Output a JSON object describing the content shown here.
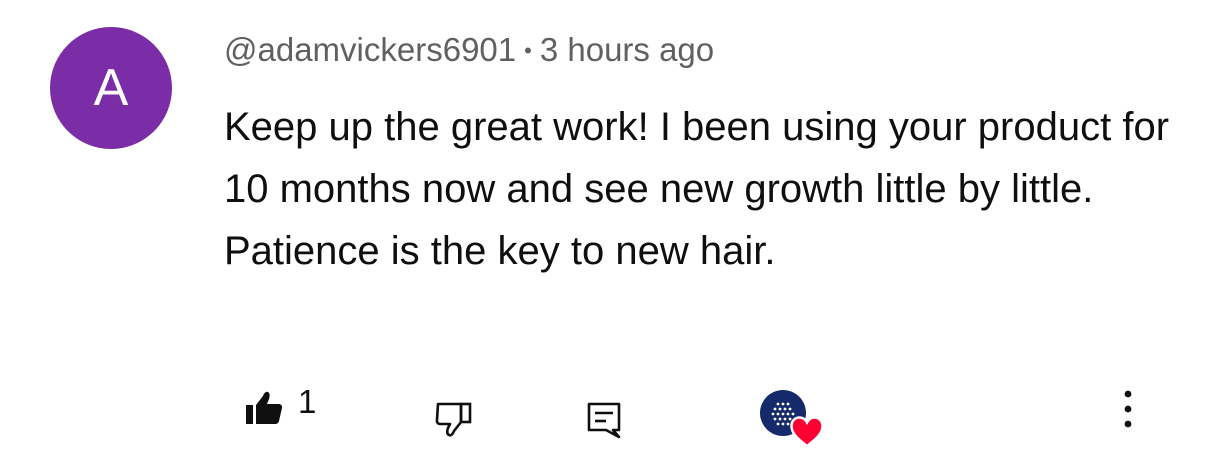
{
  "comment": {
    "avatar_letter": "A",
    "author": "@adamvickers6901",
    "separator": "•",
    "timestamp": "3 hours ago",
    "text": "Keep up the great work! I been using your product for 10 months now and see new growth little by little. Patience is the key to new hair."
  },
  "actions": {
    "like_count": "1",
    "like_icon": "thumbs-up-filled-icon",
    "dislike_icon": "thumbs-down-outline-icon",
    "reply_icon": "comment-reply-icon",
    "creator_heart_icon": "creator-heart-badge",
    "more_icon": "more-vertical-icon"
  },
  "colors": {
    "avatar_bg": "#7b2da8",
    "meta_text": "#606060",
    "body_text": "#0f0f0f",
    "creator_avatar_bg": "#152a6b",
    "heart": "#ff0033"
  }
}
